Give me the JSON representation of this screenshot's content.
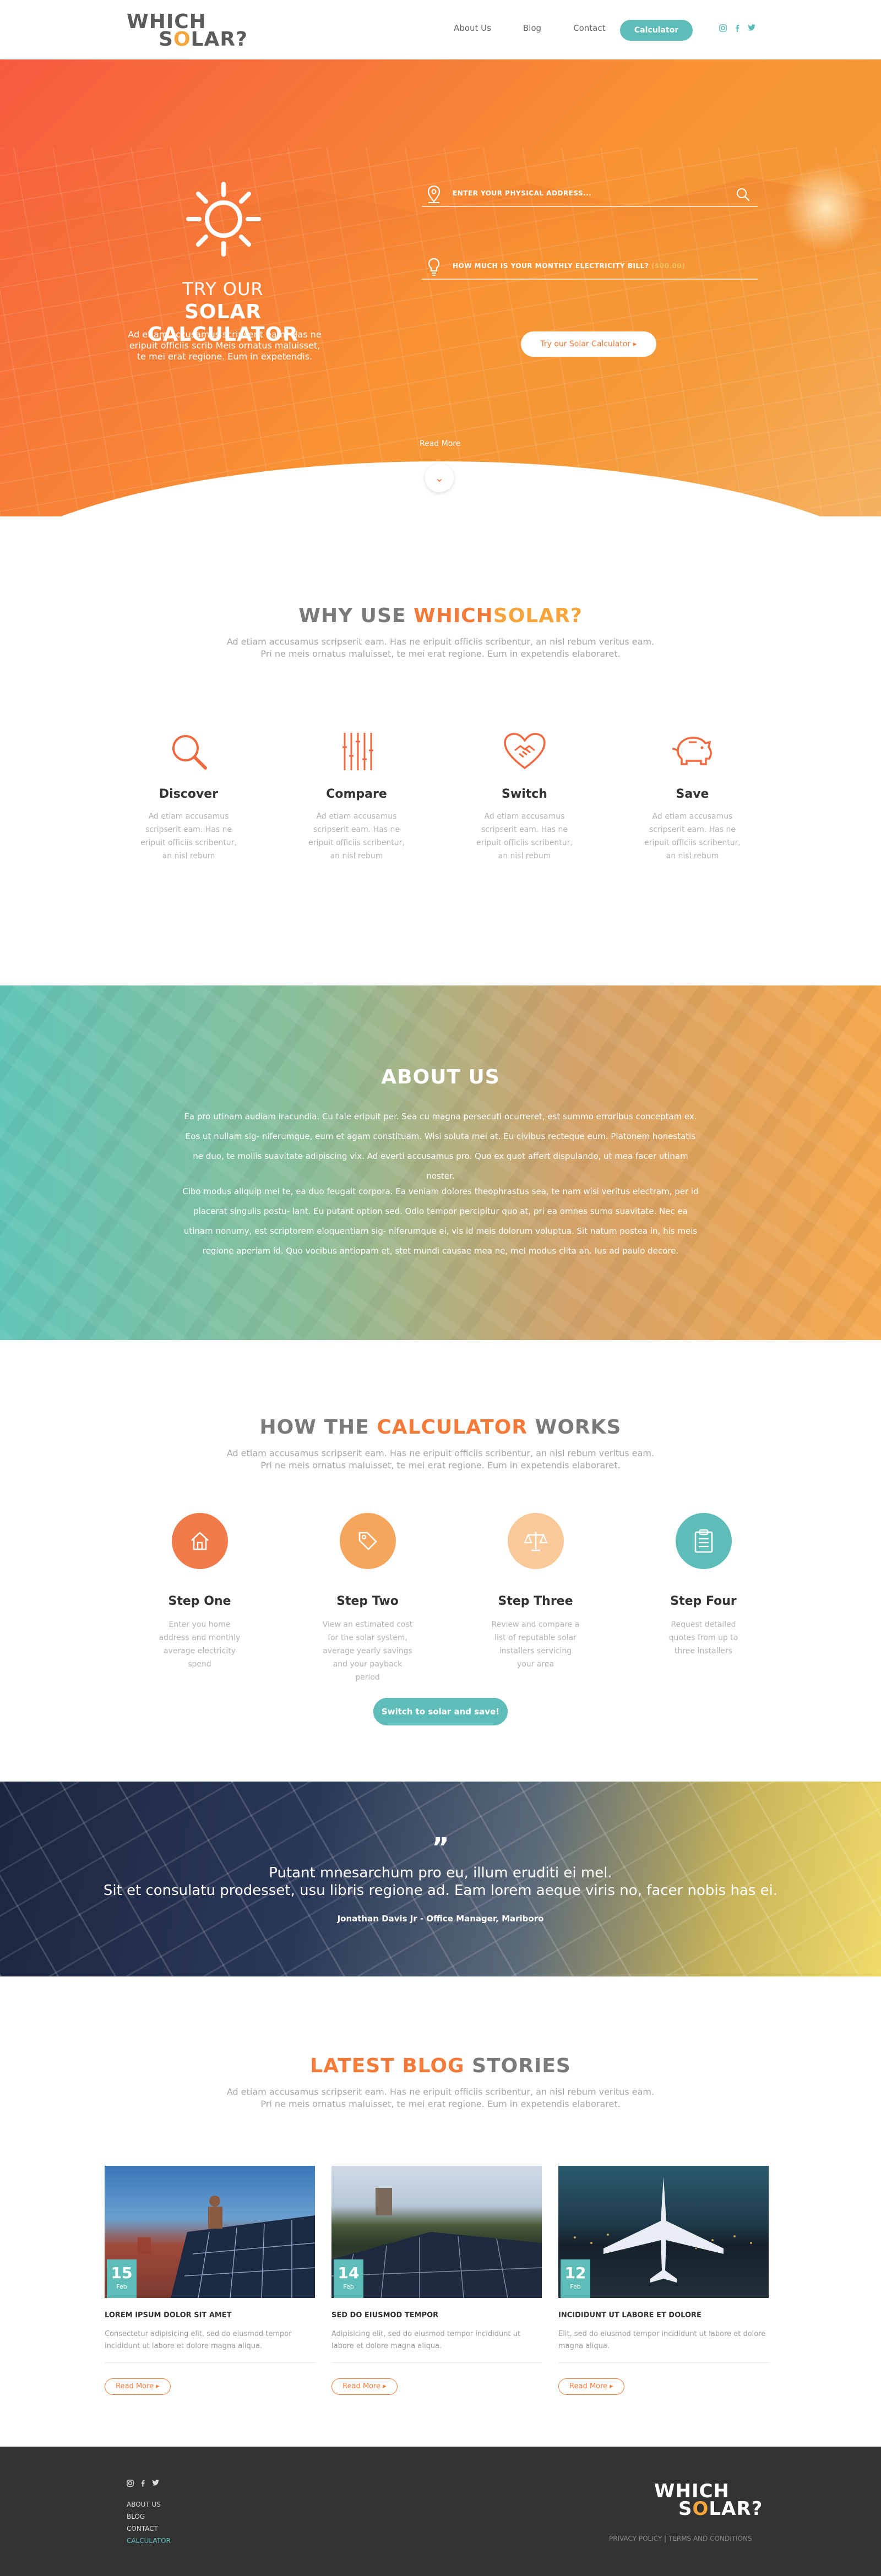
{
  "header": {
    "logo_line1": "WHICH",
    "logo_line2_pre": "S",
    "logo_line2_o": "O",
    "logo_line2_post": "LAR?",
    "nav": [
      "About Us",
      "Blog",
      "Contact"
    ],
    "calculator_label": "Calculator",
    "social_icons": [
      "instagram-icon",
      "facebook-icon",
      "twitter-icon"
    ]
  },
  "hero": {
    "title_top": "TRY OUR",
    "title_bottom": "SOLAR CALCULATOR",
    "description": "Ad etiam accusamus scripserit eam. Has ne eripuit officiis scrib Meis ornatus maluisset, te mei erat regione. Eum in expetendis.",
    "address_placeholder": "ENTER YOUR PHYSICAL ADDRESS...",
    "bill_label": "HOW MUCH IS YOUR MONTHLY ELECTRICITY BILL?",
    "bill_value": "($00.00)",
    "cta_label": "Try our Solar Calculator",
    "read_more": "Read More"
  },
  "why": {
    "title_pre": "WHY USE ",
    "title_accent": "WHICH",
    "title_accent2": "SOLAR?",
    "subtitle_line1": "Ad etiam accusamus scripserit eam. Has ne eripuit officiis scribentur, an nisl rebum veritus eam.",
    "subtitle_line2": "Pri ne meis ornatus maluisset, te mei erat regione. Eum in expetendis elaboraret.",
    "features": [
      {
        "title": "Discover",
        "text": "Ad etiam accusamus scripserit eam. Has ne eripuit officiis scribentur, an nisl rebum"
      },
      {
        "title": "Compare",
        "text": "Ad etiam accusamus scripserit eam. Has ne eripuit officiis scribentur, an nisl rebum"
      },
      {
        "title": "Switch",
        "text": "Ad etiam accusamus scripserit eam. Has ne eripuit officiis scribentur, an nisl rebum"
      },
      {
        "title": "Save",
        "text": "Ad etiam accusamus scripserit eam. Has ne eripuit officiis scribentur, an nisl rebum"
      }
    ]
  },
  "about": {
    "title": "ABOUT US",
    "p1": "Ea pro utinam audiam iracundia. Cu tale eripuit per. Sea cu magna persecuti ocurreret, est summo erroribus conceptam ex. Eos ut nullam sig- niferumque, eum et agam constituam. Wisi soluta mei at. Eu civibus recteque eum. Platonem honestatis ne duo, te mollis suavitate adipiscing vix. Ad everti accusamus pro. Quo ex quot affert dispulando, ut mea facer utinam noster.",
    "p2": "Cibo modus aliquip mei te, ea duo feugait corpora. Ea veniam dolores theophrastus sea, te nam wisi veritus electram, per id placerat singulis postu- lant. Eu putant option sed. Odio tempor percipitur quo at, pri ea omnes sumo suavitate. Nec ea utinam nonumy, est scriptorem eloquentiam sig- niferumque ei, vis id meis dolorum voluptua. Sit natum postea in, his meis regione aperiam id. Quo vocibus antiopam et, stet mundi causae mea ne, mel modus clita an. Ius ad paulo decore."
  },
  "how": {
    "title_pre": "HOW THE ",
    "title_accent": "CALCULATOR",
    "title_post": " WORKS",
    "subtitle_line1": "Ad etiam accusamus scripserit eam. Has ne eripuit officiis scribentur, an nisl rebum veritus eam.",
    "subtitle_line2": "Pri ne meis ornatus maluisset, te mei erat regione. Eum in expetendis elaboraret.",
    "steps": [
      {
        "title": "Step One",
        "text": "Enter you home address and monthly average electricity spend",
        "color": "#f07a4a",
        "icon": "home-icon"
      },
      {
        "title": "Step Two",
        "text": "View an estimated cost for the solar system, average yearly savings and your payback period",
        "color": "#f5a65c",
        "icon": "tag-icon"
      },
      {
        "title": "Step Three",
        "text": "Review and compare a list of reputable solar installers servicing your area",
        "color": "#f9c99a",
        "icon": "scale-icon"
      },
      {
        "title": "Step Four",
        "text": "Request detailed quotes from up to three installers",
        "color": "#5fbdb9",
        "icon": "clipboard-icon"
      }
    ],
    "cta_label": "Switch to solar and save!"
  },
  "quote": {
    "mark": "”",
    "line1": "Putant mnesarchum pro eu, illum eruditi ei mel.",
    "line2": "Sit et consulatu prodesset, usu libris regione ad. Eam lorem aeque viris no, facer nobis has ei.",
    "author": "Jonathan Davis Jr - Office Manager, Mariboro"
  },
  "blog": {
    "title_accent": "LATEST BLOG",
    "title_post": " STORIES",
    "subtitle_line1": "Ad etiam accusamus scripserit eam. Has ne eripuit officiis scribentur, an nisl rebum veritus eam.",
    "subtitle_line2": "Pri ne meis ornatus maluisset, te mei erat regione. Eum in expetendis elaboraret.",
    "posts": [
      {
        "day": "15",
        "month": "Feb",
        "title": "LOREM IPSUM DOLOR SIT AMET",
        "text": "Consectetur adipisicing elit, sed do eiusmod tempor incididunt ut labore et dolore magna aliqua.",
        "read_more": "Read More"
      },
      {
        "day": "14",
        "month": "Feb",
        "title": "SED DO EIUSMOD TEMPOR",
        "text": "Adipisicing elit, sed do eiusmod tempor incididunt ut labore et dolore magna aliqua.",
        "read_more": "Read More"
      },
      {
        "day": "12",
        "month": "Feb",
        "title": "INCIDIDUNT UT LABORE ET DOLORE",
        "text": "Elit, sed do eiusmod tempor incididunt ut labore et dolore magna aliqua.",
        "read_more": "Read More"
      }
    ]
  },
  "footer": {
    "links": [
      "ABOUT US",
      "BLOG",
      "CONTACT",
      "CALCULATOR"
    ],
    "legal": "PRIVACY POLICY  |  TERMS AND CONDITIONS"
  }
}
